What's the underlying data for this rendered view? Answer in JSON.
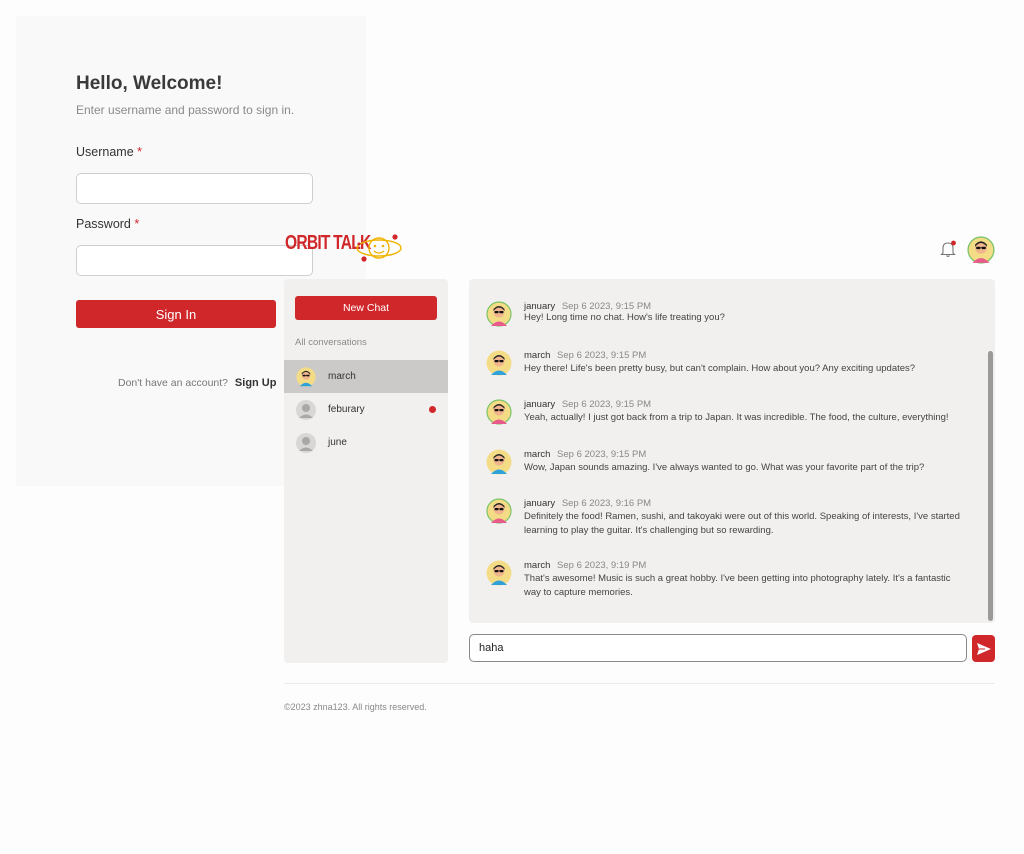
{
  "login": {
    "title": "Hello, Welcome!",
    "subtitle": "Enter username and password to sign in.",
    "username_label": "Username",
    "password_label": "Password",
    "required_mark": "*",
    "username_value": "",
    "password_value": "",
    "signin_label": "Sign In",
    "signup_prompt": "Don't have an account?",
    "signup_link": "Sign Up"
  },
  "app": {
    "logo_text": "ORBIT TALK",
    "brand_color": "#d0272b",
    "notification_icon": "bell-icon",
    "has_notification": true
  },
  "sidebar": {
    "new_chat_label": "New Chat",
    "section_label": "All conversations",
    "conversations": [
      {
        "name": "march",
        "active": true,
        "unread": false,
        "avatar": "cartoon-avatar"
      },
      {
        "name": "feburary",
        "active": false,
        "unread": true,
        "avatar": "default-avatar"
      },
      {
        "name": "june",
        "active": false,
        "unread": false,
        "avatar": "default-avatar"
      }
    ]
  },
  "messages": [
    {
      "author": "january",
      "time": "Sep 6 2023, 9:15 PM",
      "text": "Hey! Long time no chat. How's life treating you?"
    },
    {
      "author": "march",
      "time": "Sep 6 2023, 9:15 PM",
      "text": "Hey there! Life's been pretty busy, but can't complain. How about you? Any exciting updates?"
    },
    {
      "author": "january",
      "time": "Sep 6 2023, 9:15 PM",
      "text": "Yeah, actually! I just got back from a trip to Japan. It was incredible. The food, the culture, everything!"
    },
    {
      "author": "march",
      "time": "Sep 6 2023, 9:15 PM",
      "text": "Wow, Japan sounds amazing. I've always wanted to go. What was your favorite part of the trip?"
    },
    {
      "author": "january",
      "time": "Sep 6 2023, 9:16 PM",
      "text": "Definitely the food! Ramen, sushi, and takoyaki were out of this world. Speaking of interests, I've started learning to play the guitar. It's challenging but so rewarding."
    },
    {
      "author": "march",
      "time": "Sep 6 2023, 9:19 PM",
      "text": "That's awesome! Music is such a great hobby. I've been getting into photography lately. It's a fantastic way to capture memories."
    }
  ],
  "composer": {
    "value": "haha",
    "send_icon": "send-icon"
  },
  "footer": {
    "text": "©2023 zhna123. All rights reserved."
  }
}
